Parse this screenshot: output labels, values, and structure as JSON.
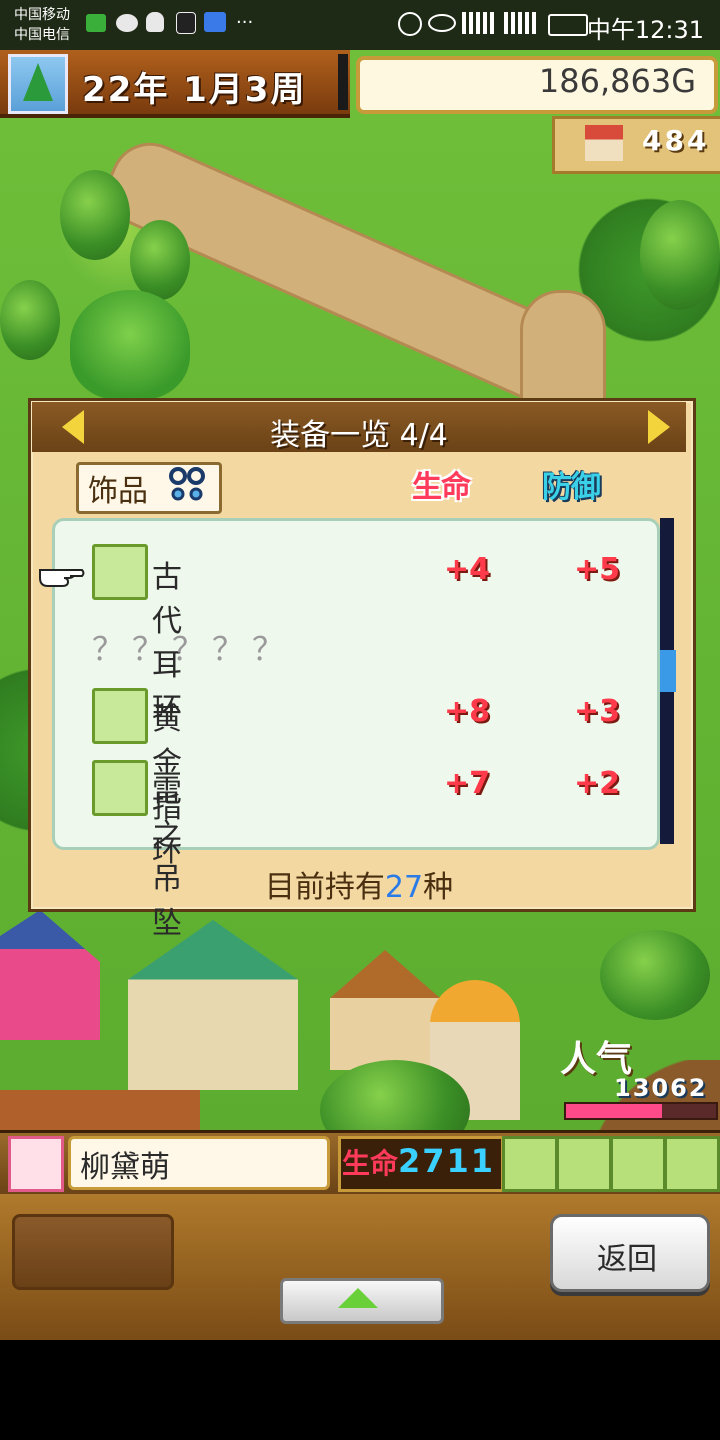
{
  "status_bar": {
    "carrier1": "中国移动",
    "carrier2": "中国电信",
    "time": "中午12:31"
  },
  "hud": {
    "date": "22年 1月3周",
    "money": "186,863G",
    "population": "484"
  },
  "equipment_panel": {
    "title": "装备一览 4/4",
    "category": "饰品",
    "col_hp": "生命",
    "col_def": "防御",
    "items": [
      {
        "name": "古代耳环",
        "hp": "+4",
        "def": "+5",
        "icon": "earring-icon"
      },
      {
        "name": "？？？？？",
        "hp": "",
        "def": "",
        "icon": ""
      },
      {
        "name": "黄金指环",
        "hp": "+8",
        "def": "+3",
        "icon": "ring-icon"
      },
      {
        "name": "雷之吊坠",
        "hp": "+7",
        "def": "+2",
        "icon": "pendant-icon"
      }
    ],
    "owned_prefix": "目前持有",
    "owned_count": "27",
    "owned_suffix": "种"
  },
  "popularity": {
    "label": "人气",
    "value": "13062",
    "level": 0.64
  },
  "character": {
    "name": "柳黛萌",
    "hp_label": "生命",
    "hp_value": "2711"
  },
  "controls": {
    "back_label": "返回"
  },
  "colors": {
    "accent_gold": "#c79a3a",
    "hp_red": "#ff3a5a",
    "def_cyan": "#3ad0e8",
    "owned_blue": "#2a7ae8"
  }
}
